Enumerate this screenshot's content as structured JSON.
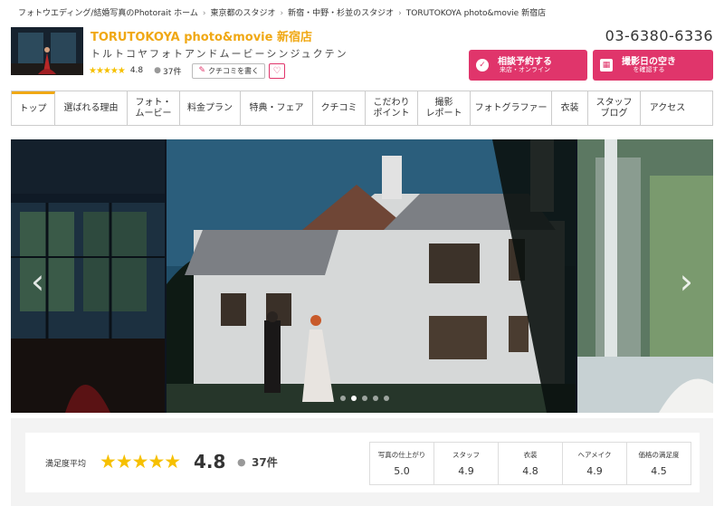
{
  "breadcrumb": [
    "フォトウエディング/結婚写真のPhotorait ホーム",
    "東京都のスタジオ",
    "新宿・中野・杉並のスタジオ",
    "TORUTOKOYA photo&movie 新宿店"
  ],
  "breadcrumb_sep": "›",
  "shop": {
    "name": "TORUTOKOYA photo&movie 新宿店",
    "kana": "トルトコヤフォトアンドムービーシンジュクテン",
    "stars": "★★★★★",
    "rating": "4.8",
    "review_count": "37件",
    "review_button": "クチコミを書く",
    "phone": "03-6380-6336"
  },
  "cta": [
    {
      "main": "相談予約する",
      "sub": "来店・オンライン",
      "icon": "check-icon"
    },
    {
      "main": "撮影日の空き",
      "sub": "を確認する",
      "icon": "calendar-icon"
    }
  ],
  "nav": [
    {
      "label": "トップ",
      "active": true
    },
    {
      "label": "選ばれる理由"
    },
    {
      "label": "フォト・\nムービー"
    },
    {
      "label": "料金プラン"
    },
    {
      "label": "特典・フェア"
    },
    {
      "label": "クチコミ"
    },
    {
      "label": "こだわり\nポイント"
    },
    {
      "label": "撮影\nレポート"
    },
    {
      "label": "フォトグラファー"
    },
    {
      "label": "衣装"
    },
    {
      "label": "スタッフ\nブログ"
    },
    {
      "label": "アクセス"
    }
  ],
  "carousel": {
    "slide_count": 5,
    "active_index": 1,
    "prev_glyph": "‹",
    "next_glyph": "›"
  },
  "summary": {
    "label": "満足度平均",
    "stars": "★★★★★",
    "rating": "4.8",
    "count": "37件",
    "sub_scores": [
      {
        "label": "写真の仕上がり",
        "value": "5.0"
      },
      {
        "label": "スタッフ",
        "value": "4.9"
      },
      {
        "label": "衣装",
        "value": "4.8"
      },
      {
        "label": "ヘアメイク",
        "value": "4.9"
      },
      {
        "label": "価格の満足度",
        "value": "4.5"
      }
    ]
  },
  "colors": {
    "accent": "#f0a814",
    "cta": "#e0356b",
    "star": "#f6c000"
  }
}
